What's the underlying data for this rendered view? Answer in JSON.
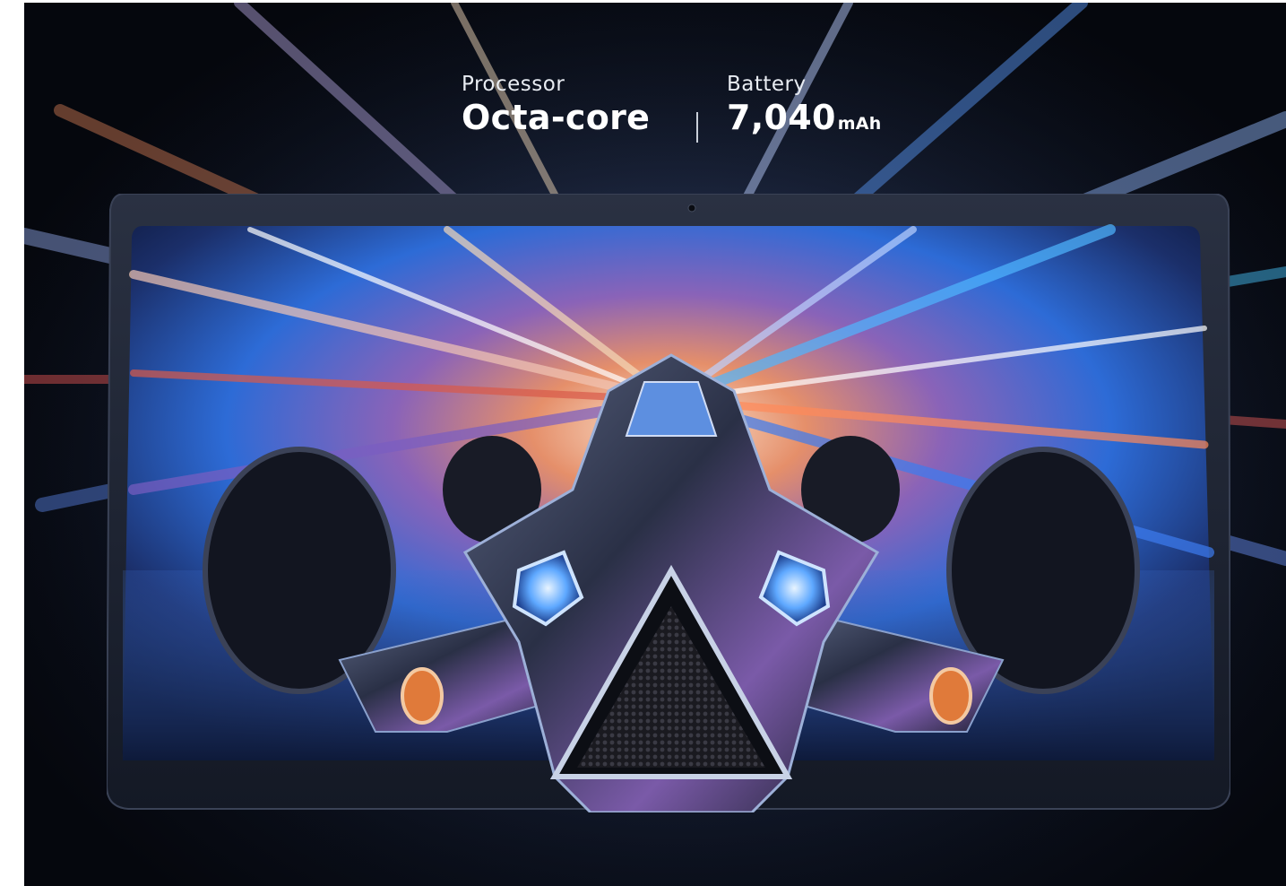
{
  "specs": {
    "processor": {
      "label": "Processor",
      "value": "Octa-core"
    },
    "battery": {
      "label": "Battery",
      "value": "7,040",
      "unit": "mAh"
    }
  },
  "colors": {
    "background": "#0d1322",
    "text": "#ffffff",
    "tablet_frame": "#1a2030"
  }
}
